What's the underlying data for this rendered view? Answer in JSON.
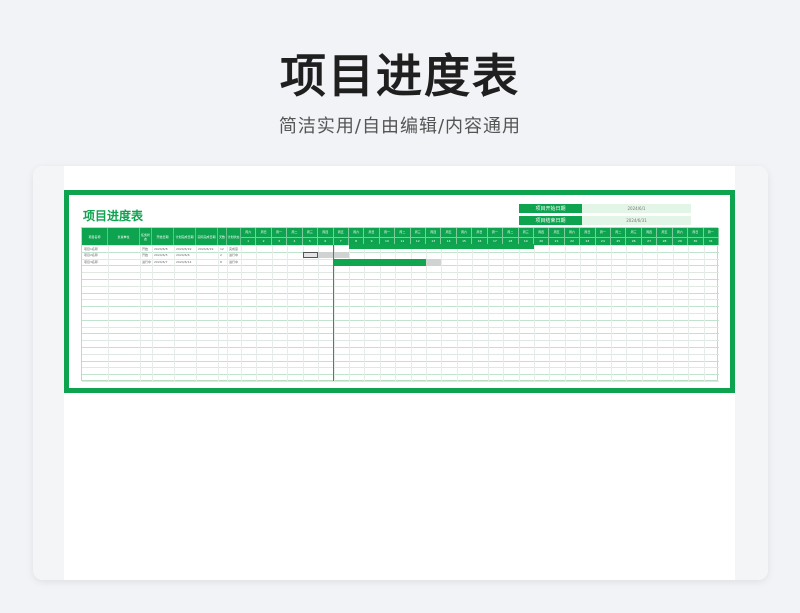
{
  "page": {
    "title": "项目进度表",
    "subtitle": "简洁实用/自由编辑/内容通用"
  },
  "sheet": {
    "title": "项目进度表",
    "info": [
      {
        "label": "项目开始日期",
        "value": "2024/6/1"
      },
      {
        "label": "项目结束日期",
        "value": "2024/6/31"
      }
    ],
    "columns": [
      "项目名称",
      "负责单位",
      "任务状态",
      "开始日期",
      "计划完成日期",
      "实际完成日期",
      "天数",
      "计划状态"
    ],
    "weekdays": [
      "周六",
      "周日",
      "周一",
      "周二",
      "周三",
      "周四",
      "周五",
      "周六",
      "周日",
      "周一",
      "周二",
      "周三",
      "周四",
      "周五",
      "周六",
      "周日",
      "周一",
      "周二",
      "周三",
      "周四",
      "周五",
      "周六",
      "周日",
      "周一",
      "周二",
      "周三",
      "周四",
      "周五",
      "周六",
      "周日",
      "周一"
    ],
    "days": [
      "1",
      "2",
      "3",
      "4",
      "5",
      "6",
      "7",
      "8",
      "9",
      "10",
      "11",
      "12",
      "13",
      "14",
      "15",
      "16",
      "17",
      "18",
      "19",
      "20",
      "21",
      "22",
      "23",
      "24",
      "25",
      "26",
      "27",
      "28",
      "29",
      "30",
      "31"
    ],
    "rows": [
      {
        "name": "项目1名称",
        "unit": "",
        "status": "开始",
        "start": "2024/6/8",
        "plan_end": "2024/6/19",
        "actual_end": "2024/6/19",
        "days": "12",
        "plan_status": "完成度"
      },
      {
        "name": "项目2名称",
        "unit": "",
        "status": "开始",
        "start": "2024/6/5",
        "plan_end": "2024/6/6",
        "actual_end": "",
        "days": "2",
        "plan_status": "进行中"
      },
      {
        "name": "项目3名称",
        "unit": "",
        "status": "进行中",
        "start": "2024/6/7",
        "plan_end": "2024/6/14",
        "actual_end": "",
        "days": "8",
        "plan_status": "进行中"
      }
    ]
  },
  "colors": {
    "accent": "#0da34f",
    "today_line": "#c94a3a"
  }
}
